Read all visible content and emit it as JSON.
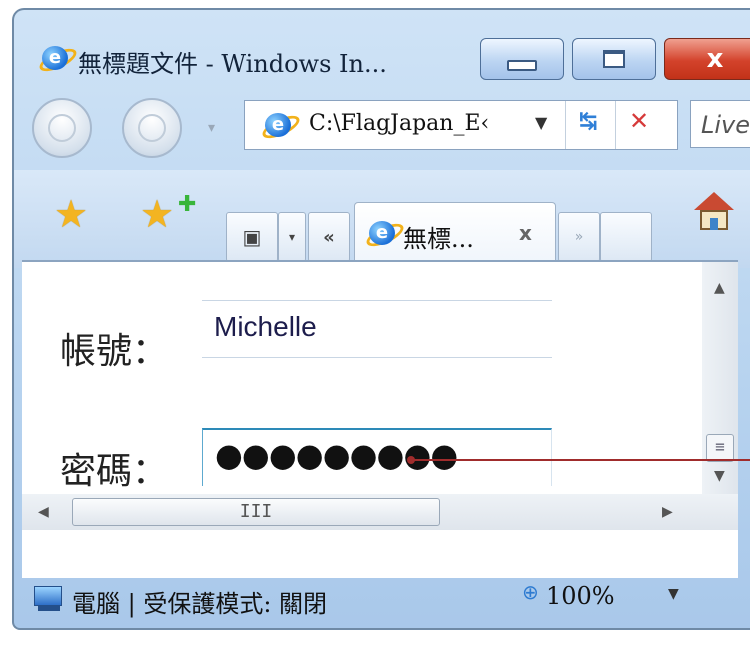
{
  "window": {
    "title": "無標題文件 - Windows In...",
    "minimize_glyph": "",
    "maximize_glyph": "",
    "close_glyph": "x"
  },
  "nav": {
    "address": "C:\\FlagJapan_E‹",
    "search_placeholder": "Live",
    "icons": [
      "back-icon",
      "forward-icon",
      "refresh-icon",
      "stop-icon",
      "ie-logo-icon"
    ]
  },
  "tabbar": {
    "tab_label": "無標...",
    "tab_close": "x",
    "quick_tabs_icon": "grid-icon",
    "chevron_left": "«",
    "chevron_right": "»"
  },
  "form": {
    "username_label": "帳號：",
    "username_value": "Michelle",
    "password_label": "密碼：",
    "password_value": "●●●●●●●●●"
  },
  "scroll": {
    "h_thumb_grip": "III",
    "v_thumb_grip": "≡"
  },
  "status": {
    "text": "電腦 | 受保護模式: 關閉",
    "zoom": "100%"
  },
  "colors": {
    "chrome_blue": "#b7d3ef",
    "close_red": "#d3422b",
    "callout": "#a02c2c"
  }
}
